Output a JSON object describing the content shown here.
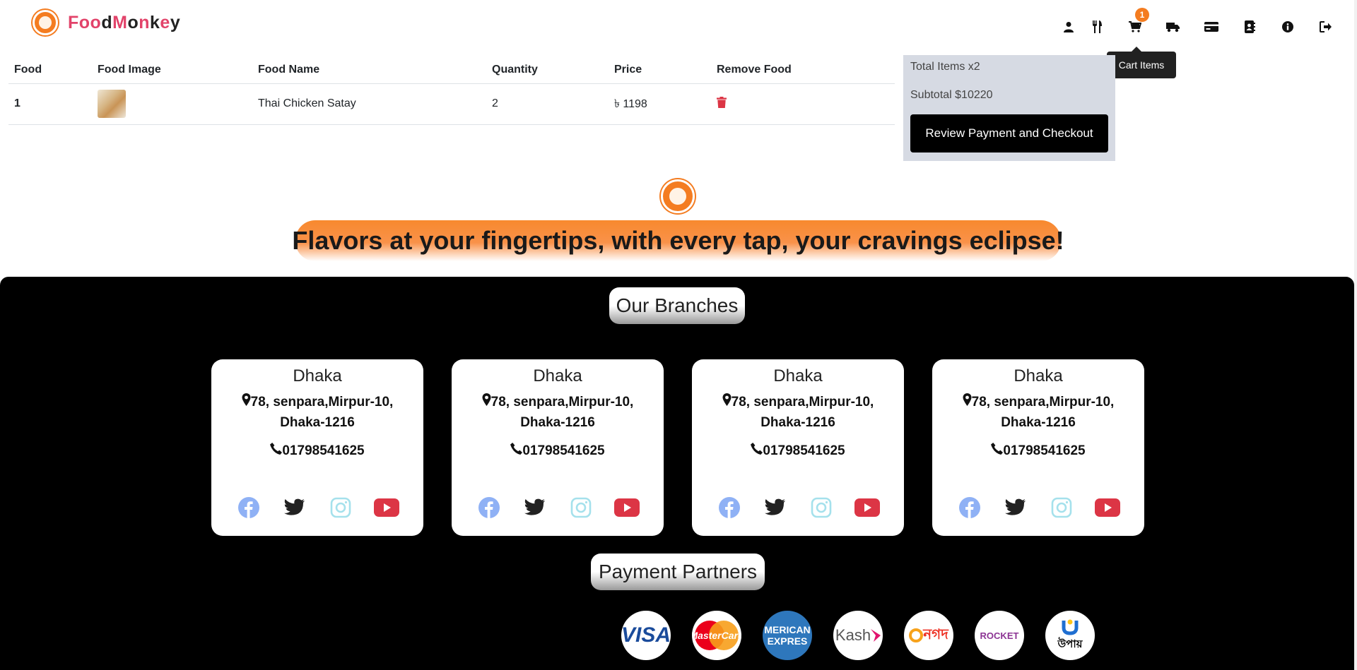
{
  "brand": {
    "name_parts": [
      "F",
      "oo",
      "d",
      "M",
      "o",
      "n",
      "k",
      "e",
      "y"
    ]
  },
  "nav": {
    "icons": [
      "user-icon",
      "utensils-icon",
      "cart-icon",
      "truck-icon",
      "credit-card-icon",
      "address-book-icon",
      "info-icon",
      "logout-icon"
    ],
    "cart_badge": "1",
    "tooltip": "Cart Items"
  },
  "cart": {
    "headers": [
      "Food",
      "Food Image",
      "Food Name",
      "Quantity",
      "Price",
      "Remove Food"
    ],
    "rows": [
      {
        "index": "1",
        "name": "Thai Chicken Satay",
        "quantity": "2",
        "price": "৳ 1198"
      }
    ]
  },
  "summary": {
    "total_items": "Total Items x2",
    "subtotal": "Subtotal $10220",
    "checkout_label": "Review Payment and Checkout"
  },
  "hero": {
    "tagline": "Flavors at your fingertips, with every tap, your cravings eclipse!"
  },
  "branches": {
    "title": "Our Branches",
    "items": [
      {
        "city": "Dhaka",
        "address": "78, senpara,Mirpur-10, Dhaka-1216",
        "phone": "01798541625"
      },
      {
        "city": "Dhaka",
        "address": "78, senpara,Mirpur-10, Dhaka-1216",
        "phone": "01798541625"
      },
      {
        "city": "Dhaka",
        "address": "78, senpara,Mirpur-10, Dhaka-1216",
        "phone": "01798541625"
      },
      {
        "city": "Dhaka",
        "address": "78, senpara,Mirpur-10, Dhaka-1216",
        "phone": "01798541625"
      }
    ]
  },
  "payments": {
    "title": "Payment Partners",
    "logos": [
      {
        "label": "VISA",
        "color": "#1a4b9b"
      },
      {
        "label": "MasterCard",
        "color": "#ffffff"
      },
      {
        "label": "MERICAN EXPRES",
        "color": "#ffffff"
      },
      {
        "label": "Kash",
        "color": "#e2136e"
      },
      {
        "label": "নগদ",
        "color": "#ee3124"
      },
      {
        "label": "ROCKET",
        "color": "#8c3494"
      },
      {
        "label": "উপায়",
        "color": "#000000"
      }
    ]
  },
  "colors": {
    "accent": "#f47c20",
    "pink": "#e2436a",
    "footer_bg": "#000000",
    "summary_bg": "#d6dae3"
  }
}
